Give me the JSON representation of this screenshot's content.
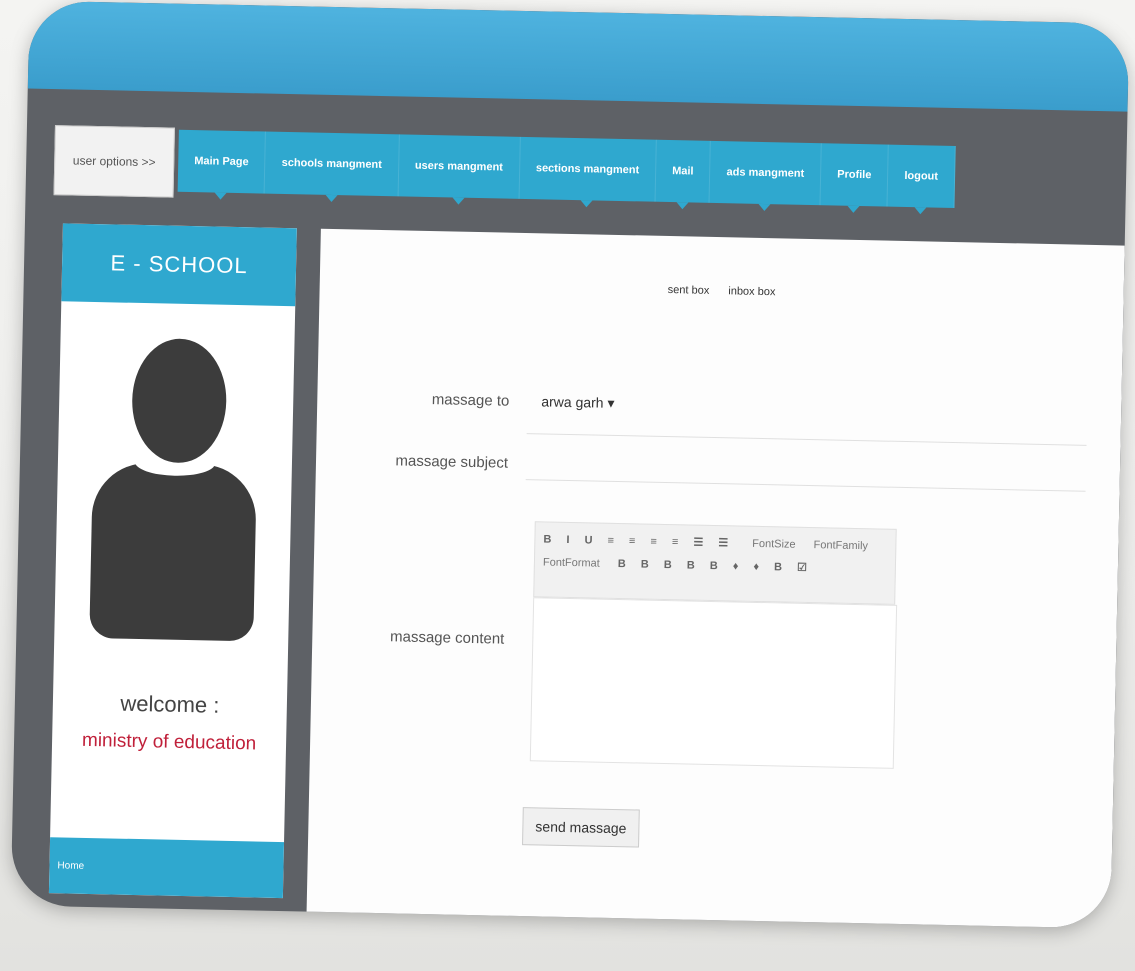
{
  "header": {
    "user_options": "user options >>",
    "nav": [
      "Main Page",
      "schools mangment",
      "users mangment",
      "sections mangment",
      "Mail",
      "ads mangment",
      "Profile",
      "logout"
    ]
  },
  "sidebar": {
    "title": "E - SCHOOL",
    "welcome": "welcome :",
    "ministry": "ministry of education",
    "footer": "Home"
  },
  "mail": {
    "tabs": [
      "sent box",
      "inbox box"
    ],
    "to_label": "massage to",
    "to_value": "arwa garh ▾",
    "subject_label": "massage subject",
    "content_label": "massage content",
    "toolbar_icons": "B I U ≡ ≡ ≡ ≡ ☰ ☰",
    "font_size": "FontSize",
    "font_family": "FontFamily",
    "font_format": "FontFormat",
    "toolbar_icons2": "B B B B B ♦ ♦ B ☑",
    "send_label": "send massage"
  }
}
